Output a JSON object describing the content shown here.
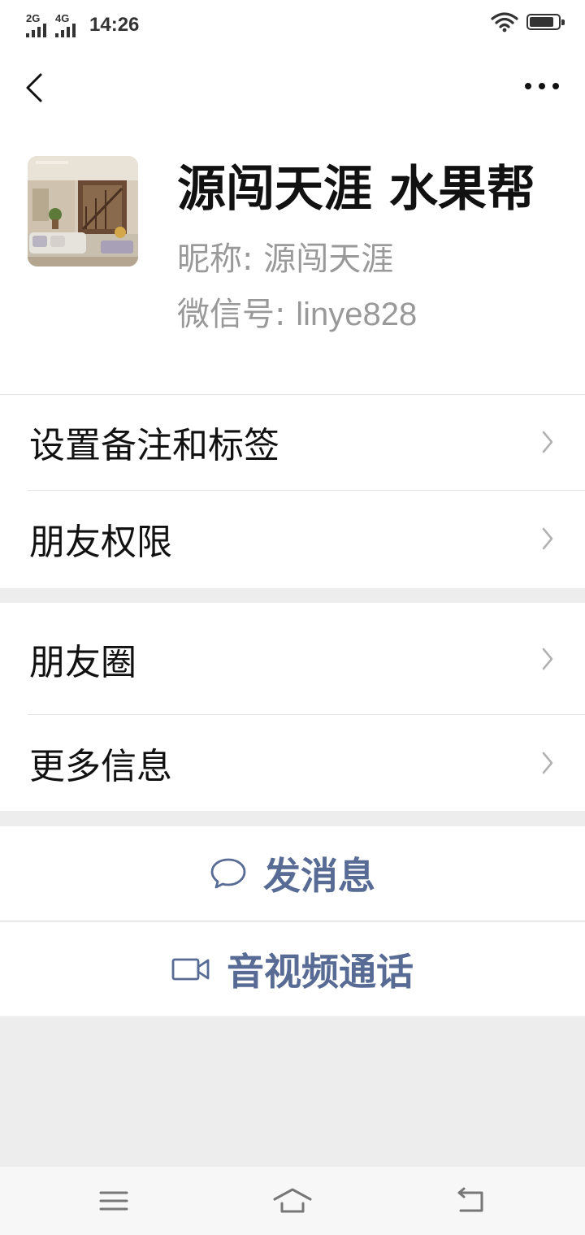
{
  "status_bar": {
    "network_1": "2G",
    "network_2": "4G",
    "time": "14:26",
    "battery_level": 0.85
  },
  "profile": {
    "display_name": "源闯天涯  水果帮",
    "nickname_label": "昵称:",
    "nickname_value": "源闯天涯",
    "wechat_id_label": "微信号:",
    "wechat_id_value": "linye828"
  },
  "menu_group_1": [
    {
      "label": "设置备注和标签"
    },
    {
      "label": "朋友权限"
    }
  ],
  "menu_group_2": [
    {
      "label": "朋友圈"
    },
    {
      "label": "更多信息"
    }
  ],
  "actions": {
    "send_message": "发消息",
    "video_call": "音视频通话"
  },
  "colors": {
    "accent": "#576b95",
    "page_bg": "#ededed",
    "secondary_text": "#999999"
  }
}
